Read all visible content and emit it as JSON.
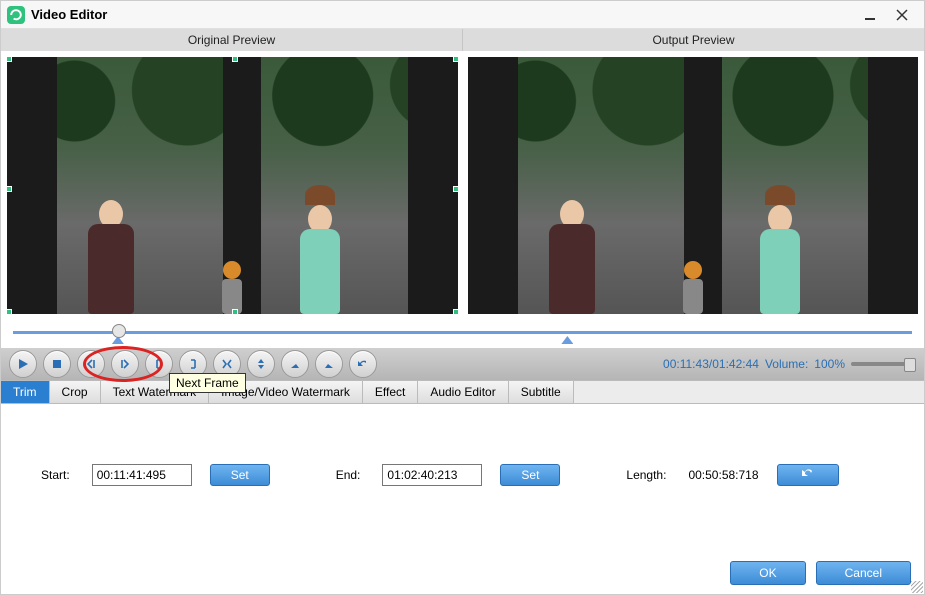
{
  "titlebar": {
    "title": "Video Editor"
  },
  "headers": {
    "original": "Original Preview",
    "output": "Output Preview"
  },
  "tooltip": "Next Frame",
  "timeInfo": {
    "current": "00:11:43",
    "total": "01:42:44",
    "volumeLabel": "Volume:",
    "volumeValue": "100%"
  },
  "tabs": {
    "trim": "Trim",
    "crop": "Crop",
    "textWatermark": "Text Watermark",
    "imageWatermark": "Image/Video Watermark",
    "effect": "Effect",
    "audio": "Audio Editor",
    "subtitle": "Subtitle"
  },
  "trim": {
    "startLabel": "Start:",
    "startValue": "00:11:41:495",
    "endLabel": "End:",
    "endValue": "01:02:40:213",
    "setLabel": "Set",
    "lengthLabel": "Length:",
    "lengthValue": "00:50:58:718"
  },
  "footer": {
    "ok": "OK",
    "cancel": "Cancel"
  }
}
